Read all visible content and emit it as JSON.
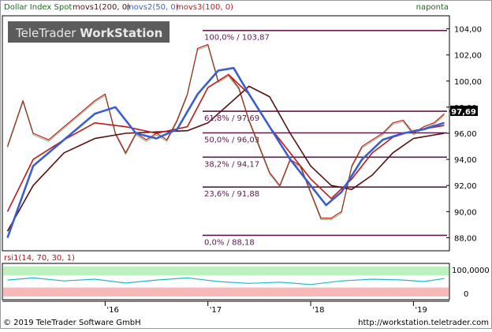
{
  "header": {
    "instrument": "Dollar Index Spot",
    "indicators": [
      {
        "label": "movs1(200, 0)",
        "color": "#5a1010"
      },
      {
        "label": "movs2(50, 0)",
        "color": "#3a5fd0"
      },
      {
        "label": "movs3(100, 0)",
        "color": "#c01818"
      }
    ],
    "frequency": "naponta"
  },
  "watermark": {
    "brand": "TeleTrader",
    "product": "WorkStation"
  },
  "footer": {
    "copyright": "© 2019 TeleTrader Software GmbH",
    "url": "http://workstation.teletrader.com"
  },
  "colors": {
    "price": "#c01818",
    "price_alt": "#2a7a2a",
    "ma200": "#5a1010",
    "ma50": "#3a5fd0",
    "fib_line": "#5a1a50",
    "rsi_line": "#20b8c8",
    "rsi_overbought_band": "#bff0bf",
    "rsi_oversold_band": "#f8b8b8",
    "last_price_box": "#000000",
    "last_price_text": "#ffffff"
  },
  "chart_data": [
    {
      "type": "line",
      "title": "Dollar Index Spot",
      "x_ticks": [
        "'16",
        "'17",
        "'18",
        "'19"
      ],
      "y_ticks": [
        "104,00",
        "102,00",
        "100,00",
        "98,00",
        "96,00",
        "94,00",
        "92,00",
        "90,00",
        "88,00"
      ],
      "ylim": [
        87.0,
        105.0
      ],
      "last_price": "97,69",
      "fibonacci_levels": [
        {
          "label": "100,0% / 103,87",
          "value": 103.87
        },
        {
          "label": "61,8% / 97,69",
          "value": 97.69
        },
        {
          "label": "50,0% / 96,03",
          "value": 96.03
        },
        {
          "label": "38,2% / 94,17",
          "value": 94.17
        },
        {
          "label": "23,6% / 91,88",
          "value": 91.88
        },
        {
          "label": "0,0% / 88,18",
          "value": 88.18
        }
      ],
      "series": [
        {
          "name": "Dollar Index Spot",
          "color": "#c01818",
          "x": [
            2015.05,
            2015.2,
            2015.3,
            2015.45,
            2015.6,
            2015.75,
            2015.9,
            2016.0,
            2016.1,
            2016.2,
            2016.3,
            2016.4,
            2016.5,
            2016.6,
            2016.7,
            2016.8,
            2016.9,
            2017.0,
            2017.1,
            2017.2,
            2017.3,
            2017.4,
            2017.5,
            2017.6,
            2017.7,
            2017.8,
            2017.9,
            2018.0,
            2018.1,
            2018.2,
            2018.3,
            2018.4,
            2018.5,
            2018.6,
            2018.7,
            2018.8,
            2018.9,
            2019.0,
            2019.1,
            2019.2,
            2019.3
          ],
          "y": [
            95.0,
            98.5,
            96.0,
            95.5,
            96.5,
            97.5,
            98.5,
            99.0,
            96.0,
            94.5,
            96.0,
            95.5,
            96.0,
            95.5,
            97.0,
            99.0,
            102.5,
            102.8,
            100.0,
            100.5,
            99.5,
            97.0,
            95.0,
            93.0,
            92.0,
            94.0,
            93.5,
            91.5,
            89.5,
            89.5,
            90.0,
            93.5,
            95.0,
            95.5,
            96.0,
            96.8,
            97.0,
            96.0,
            96.5,
            96.8,
            97.5
          ]
        },
        {
          "name": "movs1(200, 0)",
          "color": "#5a1010",
          "x": [
            2015.05,
            2015.3,
            2015.6,
            2015.9,
            2016.2,
            2016.5,
            2016.8,
            2017.0,
            2017.2,
            2017.4,
            2017.6,
            2017.8,
            2018.0,
            2018.2,
            2018.4,
            2018.6,
            2018.8,
            2019.0,
            2019.3
          ],
          "y": [
            88.5,
            92.0,
            94.5,
            95.6,
            96.0,
            96.1,
            96.2,
            96.8,
            98.2,
            99.6,
            98.8,
            96.0,
            93.5,
            92.0,
            91.7,
            92.8,
            94.5,
            95.6,
            96.0
          ]
        },
        {
          "name": "movs2(50, 0)",
          "color": "#3a5fd0",
          "x": [
            2015.05,
            2015.3,
            2015.6,
            2015.9,
            2016.1,
            2016.3,
            2016.5,
            2016.7,
            2016.9,
            2017.1,
            2017.25,
            2017.4,
            2017.6,
            2017.8,
            2018.0,
            2018.15,
            2018.3,
            2018.5,
            2018.7,
            2018.9,
            2019.1,
            2019.3
          ],
          "y": [
            88.0,
            93.5,
            95.5,
            97.5,
            98.0,
            96.0,
            95.6,
            96.3,
            99.0,
            100.8,
            101.0,
            99.0,
            96.5,
            94.0,
            92.0,
            90.5,
            91.5,
            94.0,
            95.5,
            96.0,
            96.3,
            96.8
          ]
        },
        {
          "name": "movs3(100, 0)",
          "color": "#c01818",
          "x": [
            2015.05,
            2015.3,
            2015.6,
            2015.9,
            2016.2,
            2016.5,
            2016.8,
            2017.0,
            2017.2,
            2017.4,
            2017.6,
            2017.8,
            2018.0,
            2018.2,
            2018.4,
            2018.6,
            2018.8,
            2019.0,
            2019.3
          ],
          "y": [
            90.0,
            94.0,
            95.5,
            96.8,
            96.5,
            96.0,
            96.5,
            99.5,
            100.5,
            99.0,
            96.5,
            94.5,
            92.5,
            91.0,
            92.5,
            94.5,
            95.7,
            96.2,
            96.6
          ]
        }
      ]
    },
    {
      "type": "line",
      "title": "rsi1(14, 70, 30, 1)",
      "y_ticks": [
        "100,0000",
        "0"
      ],
      "ylim": [
        0,
        100
      ],
      "bands": [
        {
          "from": 70,
          "to": 100
        },
        {
          "from": 0,
          "to": 30
        }
      ],
      "series": [
        {
          "name": "rsi1(14, 70, 30, 1)",
          "color": "#20b8c8",
          "x": [
            2015.05,
            2015.3,
            2015.6,
            2015.9,
            2016.2,
            2016.5,
            2016.8,
            2017.1,
            2017.4,
            2017.7,
            2018.0,
            2018.3,
            2018.6,
            2018.9,
            2019.1,
            2019.3
          ],
          "y": [
            55,
            62,
            52,
            58,
            45,
            55,
            62,
            50,
            44,
            48,
            40,
            52,
            58,
            55,
            50,
            60
          ]
        }
      ]
    }
  ]
}
